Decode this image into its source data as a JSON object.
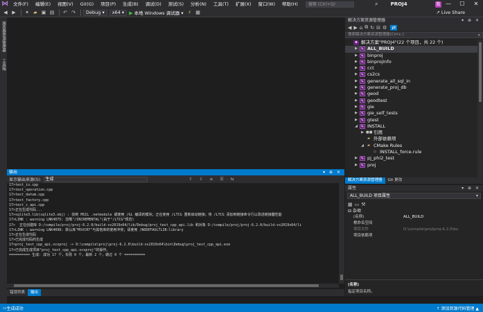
{
  "titlebar": {
    "menus": [
      "文件(F)",
      "编辑(E)",
      "视图(V)",
      "Git(G)",
      "项目(P)",
      "生成(B)",
      "调试(D)",
      "测试(S)",
      "分析(N)",
      "工具(T)",
      "扩展(X)",
      "窗口(W)",
      "帮助(H)"
    ],
    "search_placeholder": "搜索 (Ctrl+Q)",
    "project_name": "PROJ4",
    "user_badge": "我",
    "window_buttons": [
      "—",
      "☐",
      "✕"
    ]
  },
  "toolbar": {
    "config": "Debug",
    "platform": "x64",
    "run_label": "本地 Windows 调试器",
    "live_share": "Live Share"
  },
  "leftstrip": {
    "tabs": [
      "服务器资源管理器",
      "工具箱"
    ]
  },
  "output": {
    "title": "输出",
    "source_label": "显示输出来源(S):",
    "source_value": "生成",
    "lines": [
      "17>test_io.cpp",
      "17>test_operation.cpp",
      "17>test_datum.cpp",
      "17>test_factory.cpp",
      "17>test_c_api.cpp",
      "17>正在生成代码...",
      "17>sqlite3.lib(sqlite3.obj) : 找到 MSIL .netmodule 或使用 /GL 编译的模块；正在使用 /LTCG 重新启动链接；将 /LTCG 添加到链接命令行以改进链接器性能",
      "17>LINK : warning LNK4075: 忽略\"/INCREMENTAL\"(由于\"/LTCG\"规范)",
      "17>  正在创建库 D:/compile/proj/proj-6.2.0/build-vs2019x64/lib/Debug/proj_test_cpp_api.lib 和对象 D:/compile/proj/proj-6.2.0/build-vs2019x64/li",
      "17>LINK : warning LNK4098: 默认库\"MSVCRT\"与其他库的使用冲突；请使用 /NODEFAULTLIB:library",
      "17>正在生成代码",
      "17>已完成代码的生成",
      "17>proj_test_cpp_api.vcxproj -> D:\\compile\\proj\\proj-6.2.0\\build-vs2019x64\\bin\\Debug\\proj_test_cpp_api.exe",
      "17>已完成生成项目\"proj_test_cpp_api.vcxproj\"的操作。",
      "========== 生成: 成功 17 个，失败 0 个，最新 2 个，跳过 0 个 =========="
    ],
    "bottom_tabs": [
      "错误列表",
      "输出"
    ]
  },
  "solution_explorer": {
    "title": "解决方案资源管理器",
    "search_placeholder": "搜索解决方案资源管理器(Ctrl+;)",
    "items": [
      {
        "label": "解决方案\"PROJ4\"(22 个项目，共 22 个)",
        "level": 0,
        "kind": "sln",
        "expander": ""
      },
      {
        "label": "ALL_BUILD",
        "level": 1,
        "kind": "proj",
        "expander": "▶",
        "selected": true,
        "bold": true
      },
      {
        "label": "binproj",
        "level": 1,
        "kind": "proj",
        "expander": "▶"
      },
      {
        "label": "binprojinfo",
        "level": 1,
        "kind": "proj",
        "expander": "▶"
      },
      {
        "label": "cct",
        "level": 1,
        "kind": "proj",
        "expander": "▶"
      },
      {
        "label": "cs2cs",
        "level": 1,
        "kind": "proj",
        "expander": "▶"
      },
      {
        "label": "generate_all_sql_in",
        "level": 1,
        "kind": "proj",
        "expander": "▶"
      },
      {
        "label": "generate_proj_db",
        "level": 1,
        "kind": "proj",
        "expander": "▶"
      },
      {
        "label": "geod",
        "level": 1,
        "kind": "proj",
        "expander": "▶"
      },
      {
        "label": "geodtest",
        "level": 1,
        "kind": "proj",
        "expander": "▶"
      },
      {
        "label": "gie",
        "level": 1,
        "kind": "proj",
        "expander": "▶"
      },
      {
        "label": "gie_self_tests",
        "level": 1,
        "kind": "proj",
        "expander": "▶"
      },
      {
        "label": "gtest",
        "level": 1,
        "kind": "proj",
        "expander": "▶"
      },
      {
        "label": "INSTALL",
        "level": 1,
        "kind": "proj",
        "expander": "◢"
      },
      {
        "label": "引用",
        "level": 2,
        "kind": "ref",
        "expander": "▶"
      },
      {
        "label": "外部依赖项",
        "level": 2,
        "kind": "folder",
        "expander": ""
      },
      {
        "label": "CMake Rules",
        "level": 2,
        "kind": "cmake",
        "expander": "◢"
      },
      {
        "label": "INSTALL_force.rule",
        "level": 3,
        "kind": "file",
        "expander": ""
      },
      {
        "label": "pj_phi2_test",
        "level": 1,
        "kind": "proj",
        "expander": "▶"
      },
      {
        "label": "proj",
        "level": 1,
        "kind": "proj",
        "expander": "▶"
      }
    ],
    "bottom_tabs": [
      "解决方案资源管理器",
      "Git 更改"
    ]
  },
  "properties": {
    "title": "属性",
    "object": "ALL_BUILD 项目属性",
    "category": "杂项",
    "rows": [
      {
        "name": "(名称)",
        "value": "ALL_BUILD",
        "dim": false
      },
      {
        "name": "根命名空间",
        "value": "",
        "dim": false
      },
      {
        "name": "项目文件",
        "value": "D:\\compile\\proj\\proj-6.2.0\\bu",
        "dim": true
      },
      {
        "name": "项目依赖项",
        "value": "",
        "dim": false
      }
    ],
    "desc_title": "(名称)",
    "desc_text": "指定项目名称。"
  },
  "statusbar": {
    "left": "生成成功",
    "right": "↑ 添加到源代码管理 ▲"
  },
  "colors": {
    "accent": "#007acc",
    "project_icon": "#68217a",
    "badge": "#b83dba"
  }
}
